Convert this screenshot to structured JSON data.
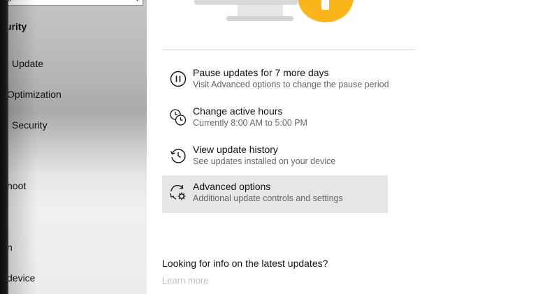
{
  "sidebar": {
    "search": {
      "visible_text": "ɔ"
    },
    "heading": "urity",
    "items": [
      {
        "label": "Update"
      },
      {
        "label": "Optimization"
      },
      {
        "label": "Security"
      },
      {
        "label": "hoot"
      },
      {
        "label": "n"
      },
      {
        "label": "device"
      }
    ]
  },
  "main": {
    "illustration": {
      "monitor_icon": "monitor-icon",
      "warning_icon": "warning-icon",
      "warning_color": "#F9B51B"
    },
    "options": [
      {
        "title": "Pause updates for 7 more days",
        "subtitle": "Visit Advanced options to change the pause period",
        "icon": "pause-icon"
      },
      {
        "title": "Change active hours",
        "subtitle": "Currently 8:00 AM to 5:00 PM",
        "icon": "active-hours-icon"
      },
      {
        "title": "View update history",
        "subtitle": "See updates installed on your device",
        "icon": "history-icon"
      },
      {
        "title": "Advanced options",
        "subtitle": "Additional update controls and settings",
        "icon": "advanced-settings-icon"
      }
    ],
    "info": {
      "heading": "Looking for info on the latest updates?",
      "link": "Learn more"
    }
  }
}
